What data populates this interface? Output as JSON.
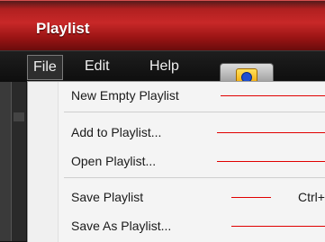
{
  "window": {
    "title": "Playlist"
  },
  "menubar": {
    "file": "File",
    "edit": "Edit",
    "help": "Help"
  },
  "file_menu": {
    "items": [
      {
        "label": "New Empty Playlist"
      },
      {
        "label": "Add to Playlist..."
      },
      {
        "label": "Open Playlist..."
      },
      {
        "label": "Save Playlist",
        "shortcut": "Ctrl+S"
      },
      {
        "label": "Save As Playlist..."
      }
    ]
  },
  "icons": {
    "tab_icon": "media-player-icon"
  },
  "colors": {
    "titlebar": "#c82828",
    "annotation_line": "#e00000",
    "menu_bg": "#f4f4f4"
  }
}
